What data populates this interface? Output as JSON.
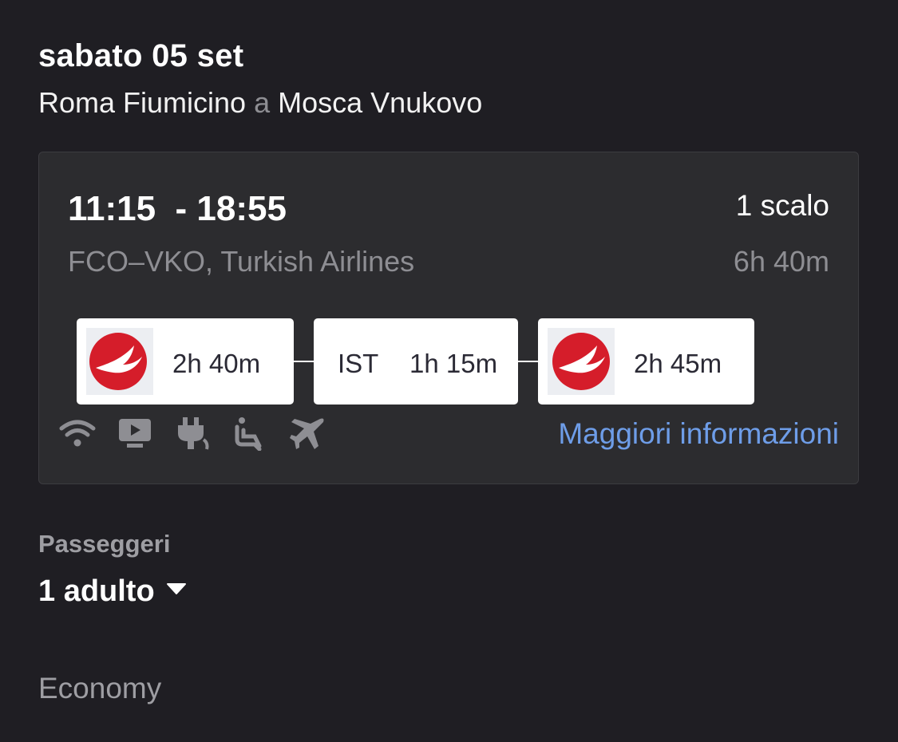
{
  "header": {
    "date": "sabato 05 set",
    "origin": "Roma Fiumicino",
    "separator": "a",
    "destination": "Mosca Vnukovo"
  },
  "flight": {
    "times": "11:15  - 18:55",
    "stops": "1 scalo",
    "route_airline": "FCO–VKO, Turkish Airlines",
    "total_duration": "6h 40m",
    "segments": [
      {
        "type": "flight",
        "logo": "turkish-airlines-logo",
        "duration": "2h 40m"
      },
      {
        "type": "layover",
        "airport": "IST",
        "duration": "1h 15m"
      },
      {
        "type": "flight",
        "logo": "turkish-airlines-logo",
        "duration": "2h 45m"
      }
    ],
    "amenities": [
      "wifi-icon",
      "entertainment-icon",
      "power-icon",
      "legroom-seat-icon",
      "flight-icon"
    ],
    "more_info": "Maggiori informazioni"
  },
  "passengers": {
    "label": "Passeggeri",
    "value": "1 adulto"
  },
  "cabin_class": "Economy",
  "colors": {
    "background": "#1f1e23",
    "card": "#2c2c2f",
    "link": "#6e9de8",
    "turkish_red": "#d51d2a"
  }
}
